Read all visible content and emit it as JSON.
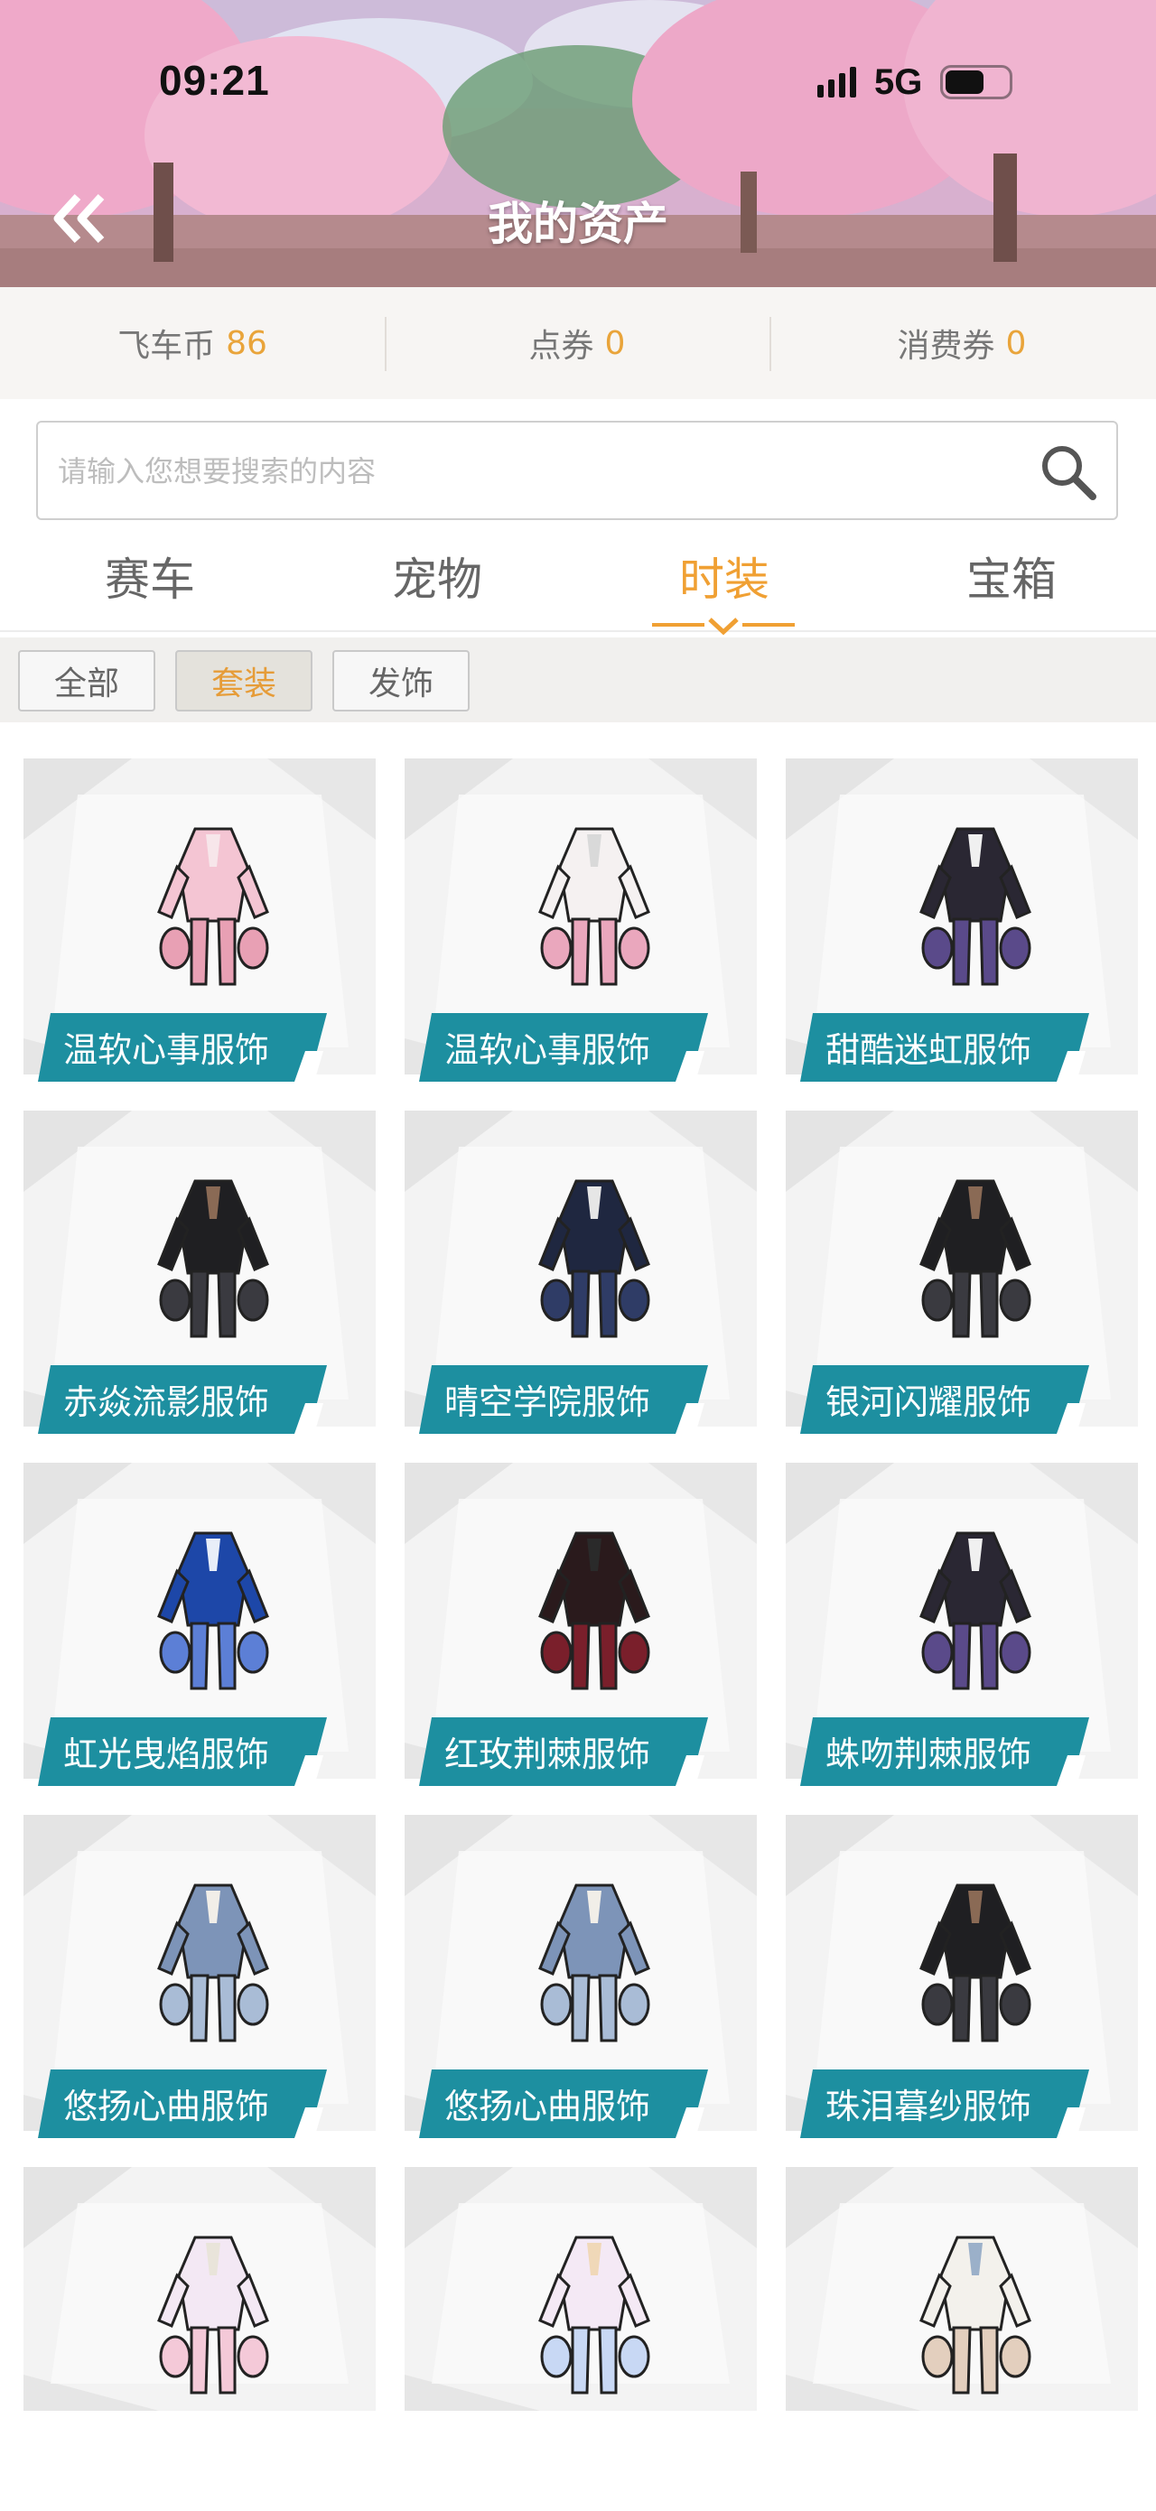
{
  "status": {
    "time": "09:21",
    "network": "5G"
  },
  "header": {
    "title": "我的资产"
  },
  "assets": [
    {
      "label": "飞车币",
      "value": "86"
    },
    {
      "label": "点券",
      "value": "0"
    },
    {
      "label": "消费券",
      "value": "0"
    }
  ],
  "search": {
    "placeholder": "请输入您想要搜索的内容"
  },
  "tabs": [
    "赛车",
    "宠物",
    "时装",
    "宝箱"
  ],
  "active_tab": 2,
  "filters": [
    "全部",
    "套装",
    "发饰"
  ],
  "active_filter": 1,
  "items": [
    {
      "name": "温软心事服饰",
      "palette": "pink"
    },
    {
      "name": "温软心事服饰",
      "palette": "pink-white"
    },
    {
      "name": "甜酷迷虹服饰",
      "palette": "black-purple"
    },
    {
      "name": "赤焱流影服饰",
      "palette": "black"
    },
    {
      "name": "晴空学院服饰",
      "palette": "navy"
    },
    {
      "name": "银河闪耀服饰",
      "palette": "black"
    },
    {
      "name": "虹光曳焰服饰",
      "palette": "blue"
    },
    {
      "name": "红玫荆棘服饰",
      "palette": "red-black"
    },
    {
      "name": "蛛吻荆棘服饰",
      "palette": "black-purple"
    },
    {
      "name": "悠扬心曲服饰",
      "palette": "denim"
    },
    {
      "name": "悠扬心曲服饰",
      "palette": "denim"
    },
    {
      "name": "珠泪暮纱服饰",
      "palette": "black"
    },
    {
      "name": "",
      "palette": "pastel-girl"
    },
    {
      "name": "",
      "palette": "pastel"
    },
    {
      "name": "",
      "palette": "boy"
    }
  ],
  "colors": {
    "accent": "#f0a033",
    "label_bg": "#1d8fa0",
    "value": "#e9a43a"
  }
}
